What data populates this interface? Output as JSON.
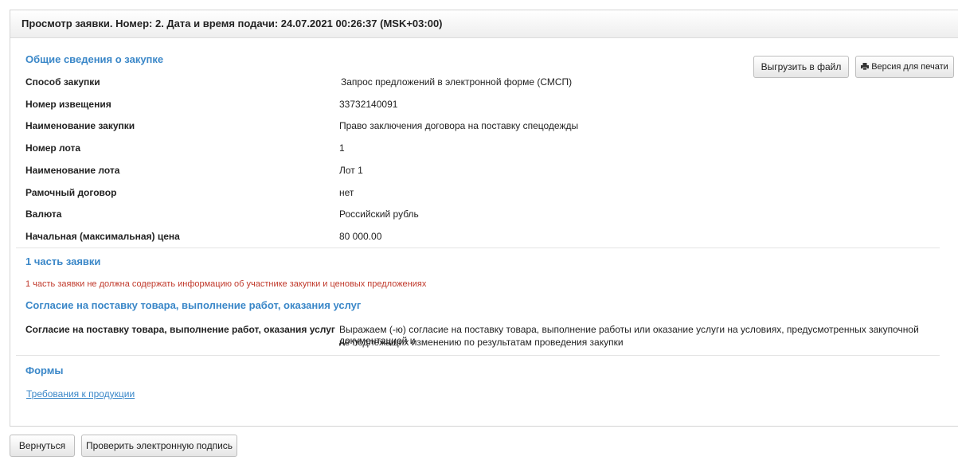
{
  "header": {
    "title": "Просмотр заявки. Номер: 2. Дата и время подачи: 24.07.2021 00:26:37 (MSK+03:00)"
  },
  "toolbar": {
    "export_label": "Выгрузить в файл",
    "print_label": "Версия для печати"
  },
  "general": {
    "title": "Общие сведения о закупке",
    "rows": [
      {
        "label": "Способ закупки",
        "value": "Запрос предложений в электронной форме (СМСП)"
      },
      {
        "label": "Номер извещения",
        "value": "33732140091"
      },
      {
        "label": "Наименование закупки",
        "value": "Право заключения договора на поставку спецодежды"
      },
      {
        "label": "Номер лота",
        "value": "1"
      },
      {
        "label": "Наименование лота",
        "value": "Лот 1"
      },
      {
        "label": "Рамочный договор",
        "value": "нет"
      },
      {
        "label": "Валюта",
        "value": "Российский рубль"
      },
      {
        "label": "Начальная (максимальная) цена",
        "value": "80 000.00"
      }
    ]
  },
  "part1": {
    "title": "1 часть заявки",
    "warning": "1 часть заявки не должна содержать информацию об участнике закупки и ценовых предложениях"
  },
  "consent": {
    "title": "Согласие на поставку товара, выполнение работ, оказания услуг",
    "label": "Согласие на поставку товара, выполнение работ, оказания услуг",
    "value_line1": "Выражаем (-ю) согласие на поставку товара, выполнение работы или оказание услуги на условиях, предусмотренных закупочной документацией и",
    "value_line2": "не подлежащих изменению по результатам проведения закупки"
  },
  "forms": {
    "title": "Формы",
    "link": "Требования к продукции"
  },
  "footer": {
    "back_label": "Вернуться",
    "verify_label": "Проверить электронную подпись"
  }
}
